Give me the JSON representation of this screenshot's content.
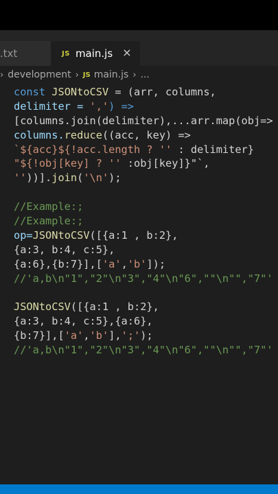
{
  "tabs": [
    {
      "label": "t.txt",
      "active": false
    },
    {
      "label": "main.js",
      "icon": "JS",
      "active": true
    }
  ],
  "close_icon": "×",
  "breadcrumb": {
    "folder": "development",
    "file_icon": "JS",
    "file": "main.js",
    "ellipsis": "..."
  },
  "code": {
    "l1_kw": "const",
    "l1_name": "JSONtoCSV",
    "l1_rest": " = (arr, columns,",
    "l2_a": "delimiter = ",
    "l2_str": "','",
    "l2_b": ") =>",
    "l3": "[columns.join(delimiter),...arr.map(obj=>",
    "l4_a": "columns.",
    "l4_fn": "reduce",
    "l4_b": "((acc, key) =>",
    "l5_a": "`${acc}${!acc.length ? ",
    "l5_str": "''",
    "l5_b": " : delimiter}",
    "l6_a": "\"${!obj[key] ? ",
    "l6_str": "''",
    "l6_b": " :obj[key]}\"`,",
    "l7_str": "''",
    "l7_a": "))].",
    "l7_fn": "join",
    "l7_b": "(",
    "l7_str2": "'\\n'",
    "l7_c": ");",
    "c1": "//Example:;",
    "c2": "//Example:;",
    "l10_a": "op=",
    "l10_fn": "JSONtoCSV",
    "l10_b": "([{a:1 , b:2},",
    "l11": "{a:3, b:4, c:5},",
    "l12_a": "{a:6},{b:7}],[",
    "l12_s1": "'a'",
    "l12_b": ",",
    "l12_s2": "'b'",
    "l12_c": "]);",
    "c3": "//'a,b\\n\"1\",\"2\"\\n\"3\",\"4\"\\n\"6\",\"\"\\n\"\",\"7\"'",
    "l15_fn": "JSONtoCSV",
    "l15_b": "([{a:1 , b:2},",
    "l16": "{a:3, b:4, c:5},{a:6},",
    "l17_a": "{b:7}],[",
    "l17_s1": "'a'",
    "l17_b": ",",
    "l17_s2": "'b'",
    "l17_c": "],",
    "l17_s3": "';'",
    "l17_d": ");",
    "c4": "//'a,b\\n\"1\",\"2\"\\n\"3\",\"4\"\\n\"6\",\"\"\\n\"\",\"7\"'"
  },
  "colors": {
    "editor_bg": "#1e1e1e",
    "keyword": "#569cd6",
    "function": "#dcdcaa",
    "string": "#ce9178",
    "comment": "#6a9955",
    "statusbar": "#007acc"
  }
}
